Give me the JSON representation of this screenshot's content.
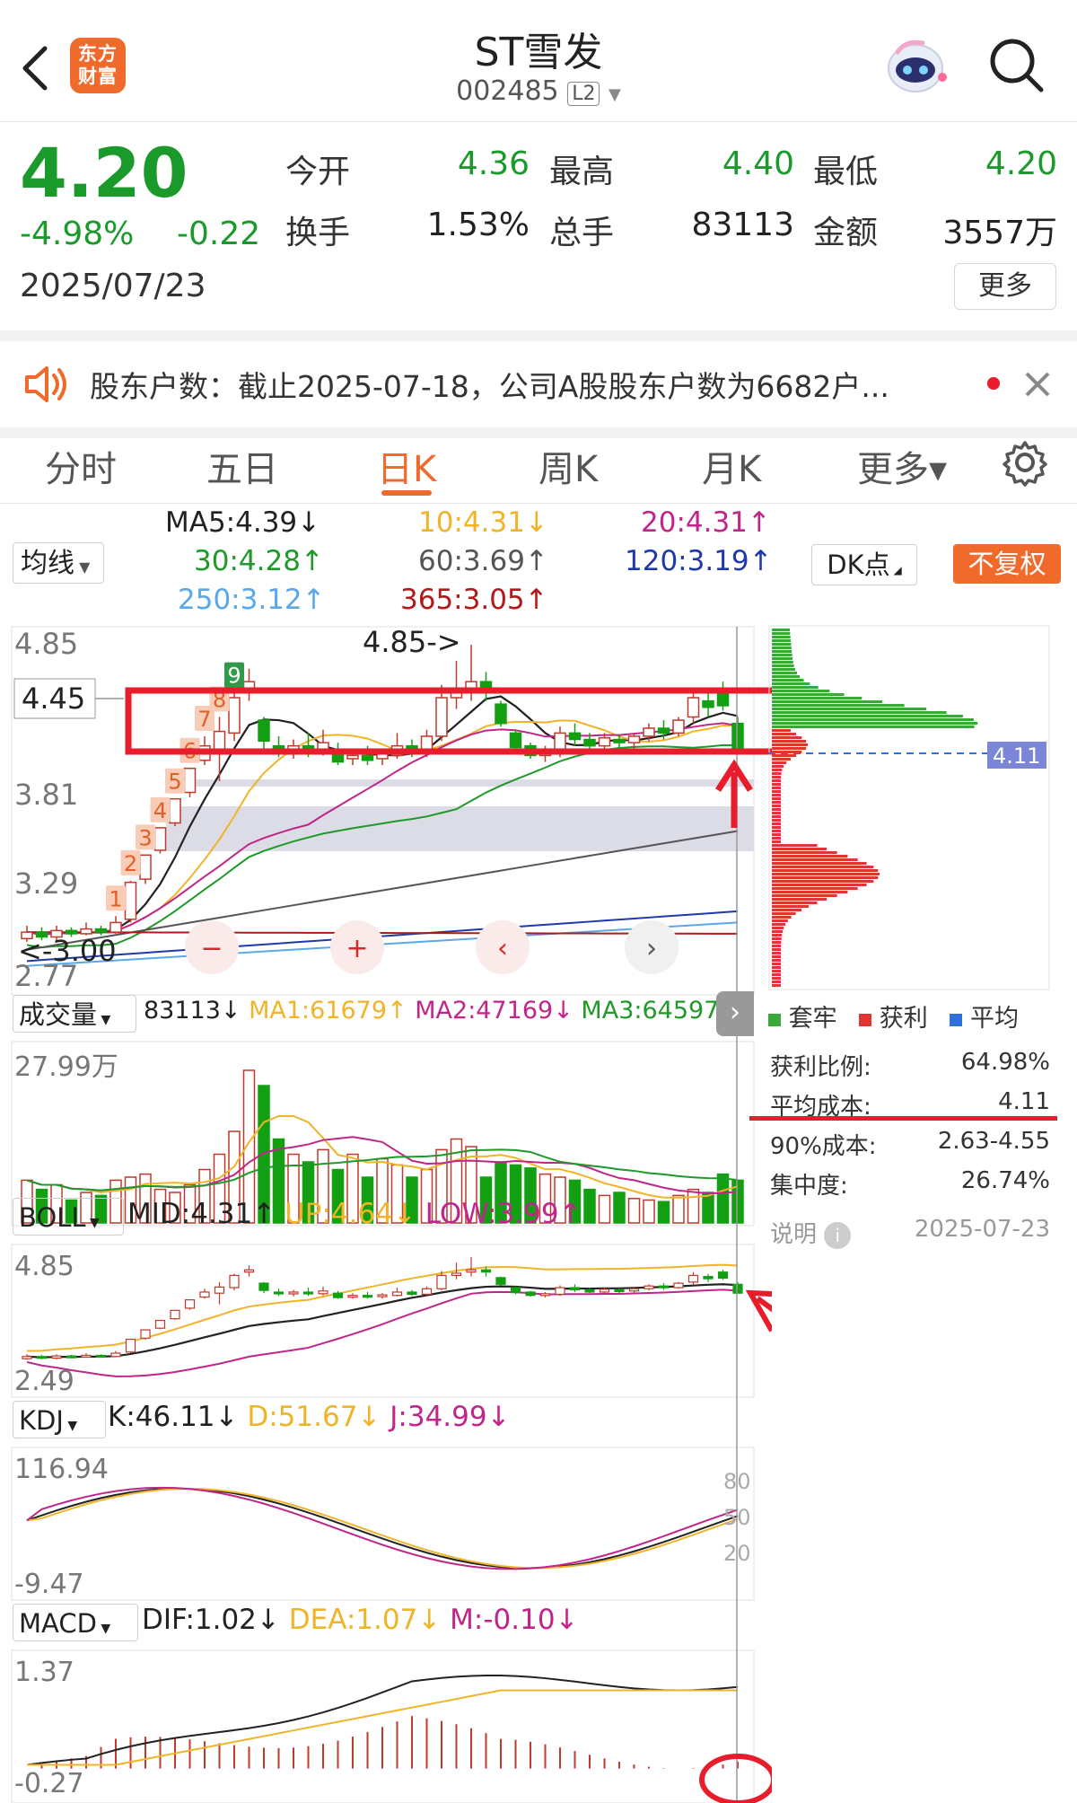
{
  "header": {
    "title": "ST雪发",
    "code": "002485",
    "level_badge": "L2",
    "app_logo_text": "东方财富",
    "icons": [
      "back-arrow-icon",
      "app-logo-icon",
      "robot-assistant-icon",
      "search-icon"
    ]
  },
  "quote": {
    "price": "4.20",
    "change_pct": "-4.98%",
    "change_amt": "-0.22",
    "date": "2025/07/23",
    "fields": [
      {
        "label": "今开",
        "value": "4.36",
        "color": "#1a9a2a"
      },
      {
        "label": "最高",
        "value": "4.40",
        "color": "#1a9a2a"
      },
      {
        "label": "最低",
        "value": "4.20",
        "color": "#1a9a2a"
      },
      {
        "label": "换手",
        "value": "1.53%",
        "color": "#222222"
      },
      {
        "label": "总手",
        "value": "83113",
        "color": "#222222"
      },
      {
        "label": "金额",
        "value": "3557万",
        "color": "#222222"
      }
    ],
    "more_button": "更多"
  },
  "notice": {
    "text": "股东户数：截止2025-07-18，公司A股股东户数为6682户...",
    "icons": [
      "speaker-icon",
      "red-dot-icon",
      "close-icon"
    ]
  },
  "tabs": {
    "items": [
      "分时",
      "五日",
      "日K",
      "周K",
      "月K",
      "更多▾"
    ],
    "active_index": 2,
    "settings_icon": "gear-icon"
  },
  "ma_panel": {
    "selector": "均线",
    "ma5": "MA5:4.39↓",
    "ma10": "10:4.31↓",
    "ma20": "20:4.31↑",
    "ma30": "30:4.28↑",
    "ma60": "60:3.69↑",
    "ma120": "120:3.19↑",
    "ma250": "250:3.12↑",
    "ma365": "365:3.05↑",
    "dk_button": "DK点",
    "adjust_button": "不复权",
    "colors": {
      "ma5": "#222222",
      "ma10": "#f0b429",
      "ma20": "#c0268a",
      "ma30": "#1f9a2a",
      "ma60": "#555555",
      "ma120": "#1f3aa8",
      "ma250": "#5aa8e8",
      "ma365": "#b01a1a"
    }
  },
  "main_chart": {
    "y_ticks": [
      "4.85",
      "4.45",
      "3.81",
      "3.29",
      "2.77"
    ],
    "high_annotation": "4.85->",
    "low_annotation": "<-3.00",
    "nine_turn_labels": [
      "1",
      "2",
      "3",
      "4",
      "5",
      "6",
      "7",
      "8",
      "9"
    ],
    "cost_label": "4.11"
  },
  "chip_legend": {
    "items": [
      {
        "label": "套牢",
        "color": "#3aa83a"
      },
      {
        "label": "获利",
        "color": "#e03535"
      },
      {
        "label": "平均",
        "color": "#2f6fd8"
      }
    ]
  },
  "chip_stats": {
    "rows": [
      {
        "label": "获利比例:",
        "value": "64.98%"
      },
      {
        "label": "平均成本:",
        "value": "4.11"
      },
      {
        "label": "90%成本:",
        "value": "2.63-4.55"
      },
      {
        "label": "集中度:",
        "value": "26.74%"
      }
    ],
    "explain": "说明",
    "date": "2025-07-23"
  },
  "volume_panel": {
    "selector": "成交量",
    "vol": "83113↓",
    "ma1": "MA1:61679↑",
    "ma2": "MA2:47169↓",
    "ma3": "MA3:64597↑",
    "y_top": "27.99万"
  },
  "boll_panel": {
    "selector": "BOLL",
    "mid": "MID:4.31↑",
    "up": "UP:4.64↓",
    "low": "LOW:3.99↑",
    "y_top": "4.85",
    "y_bottom": "2.49"
  },
  "kdj_panel": {
    "selector": "KDJ",
    "k": "K:46.11↓",
    "d": "D:51.67↓",
    "j": "J:34.99↓",
    "y_top": "116.94",
    "y_bottom": "-9.47",
    "levels": [
      "80",
      "50",
      "20"
    ]
  },
  "macd_panel": {
    "selector": "MACD",
    "dif": "DIF:1.02↓",
    "dea": "DEA:1.07↓",
    "m": "M:-0.10↓",
    "y_top": "1.37",
    "y_bottom": "-0.27"
  },
  "candles": [
    {
      "o": 3.02,
      "c": 3.06,
      "h": 3.1,
      "l": 3.0
    },
    {
      "o": 3.06,
      "c": 3.03,
      "h": 3.09,
      "l": 3.01
    },
    {
      "o": 3.03,
      "c": 3.07,
      "h": 3.1,
      "l": 3.01
    },
    {
      "o": 3.07,
      "c": 3.05,
      "h": 3.09,
      "l": 3.03
    },
    {
      "o": 3.05,
      "c": 3.08,
      "h": 3.12,
      "l": 3.04
    },
    {
      "o": 3.08,
      "c": 3.06,
      "h": 3.1,
      "l": 3.04
    },
    {
      "o": 3.06,
      "c": 3.12,
      "h": 3.16,
      "l": 3.05
    },
    {
      "o": 3.14,
      "c": 3.37,
      "h": 3.38,
      "l": 3.12
    },
    {
      "o": 3.39,
      "c": 3.54,
      "h": 3.54,
      "l": 3.36
    },
    {
      "o": 3.57,
      "c": 3.71,
      "h": 3.71,
      "l": 3.55
    },
    {
      "o": 3.74,
      "c": 3.89,
      "h": 3.89,
      "l": 3.72
    },
    {
      "o": 3.93,
      "c": 4.08,
      "h": 4.08,
      "l": 3.9
    },
    {
      "o": 4.13,
      "c": 4.22,
      "h": 4.28,
      "l": 4.1
    },
    {
      "o": 4.2,
      "c": 4.31,
      "h": 4.4,
      "l": 4.0
    },
    {
      "o": 4.3,
      "c": 4.52,
      "h": 4.55,
      "l": 4.25
    },
    {
      "o": 4.58,
      "c": 4.62,
      "h": 4.7,
      "l": 4.5
    },
    {
      "o": 4.38,
      "c": 4.25,
      "h": 4.4,
      "l": 4.2
    },
    {
      "o": 4.22,
      "c": 4.2,
      "h": 4.28,
      "l": 4.15
    },
    {
      "o": 4.2,
      "c": 4.22,
      "h": 4.26,
      "l": 4.14
    },
    {
      "o": 4.22,
      "c": 4.19,
      "h": 4.3,
      "l": 4.15
    },
    {
      "o": 4.19,
      "c": 4.24,
      "h": 4.32,
      "l": 4.16
    },
    {
      "o": 4.2,
      "c": 4.12,
      "h": 4.24,
      "l": 4.1
    },
    {
      "o": 4.14,
      "c": 4.16,
      "h": 4.2,
      "l": 4.1
    },
    {
      "o": 4.16,
      "c": 4.13,
      "h": 4.22,
      "l": 4.1
    },
    {
      "o": 4.14,
      "c": 4.17,
      "h": 4.2,
      "l": 4.1
    },
    {
      "o": 4.16,
      "c": 4.22,
      "h": 4.3,
      "l": 4.14
    },
    {
      "o": 4.22,
      "c": 4.18,
      "h": 4.26,
      "l": 4.15
    },
    {
      "o": 4.18,
      "c": 4.28,
      "h": 4.32,
      "l": 4.15
    },
    {
      "o": 4.28,
      "c": 4.52,
      "h": 4.6,
      "l": 4.25
    },
    {
      "o": 4.52,
      "c": 4.56,
      "h": 4.75,
      "l": 4.45
    },
    {
      "o": 4.58,
      "c": 4.62,
      "h": 4.85,
      "l": 4.5
    },
    {
      "o": 4.62,
      "c": 4.58,
      "h": 4.68,
      "l": 4.5
    },
    {
      "o": 4.48,
      "c": 4.36,
      "h": 4.5,
      "l": 4.34
    },
    {
      "o": 4.3,
      "c": 4.21,
      "h": 4.32,
      "l": 4.18
    },
    {
      "o": 4.22,
      "c": 4.16,
      "h": 4.24,
      "l": 4.14
    },
    {
      "o": 4.16,
      "c": 4.19,
      "h": 4.22,
      "l": 4.12
    },
    {
      "o": 4.18,
      "c": 4.3,
      "h": 4.34,
      "l": 4.15
    },
    {
      "o": 4.3,
      "c": 4.26,
      "h": 4.36,
      "l": 4.22
    },
    {
      "o": 4.26,
      "c": 4.22,
      "h": 4.3,
      "l": 4.2
    },
    {
      "o": 4.22,
      "c": 4.27,
      "h": 4.3,
      "l": 4.18
    },
    {
      "o": 4.26,
      "c": 4.24,
      "h": 4.29,
      "l": 4.2
    },
    {
      "o": 4.24,
      "c": 4.28,
      "h": 4.3,
      "l": 4.2
    },
    {
      "o": 4.28,
      "c": 4.33,
      "h": 4.36,
      "l": 4.25
    },
    {
      "o": 4.33,
      "c": 4.3,
      "h": 4.38,
      "l": 4.26
    },
    {
      "o": 4.3,
      "c": 4.38,
      "h": 4.4,
      "l": 4.28
    },
    {
      "o": 4.4,
      "c": 4.52,
      "h": 4.58,
      "l": 4.36
    },
    {
      "o": 4.5,
      "c": 4.46,
      "h": 4.55,
      "l": 4.4
    },
    {
      "o": 4.58,
      "c": 4.47,
      "h": 4.62,
      "l": 4.44
    },
    {
      "o": 4.36,
      "c": 4.2,
      "h": 4.4,
      "l": 4.2
    }
  ],
  "volumes": [
    0.28,
    0.22,
    0.25,
    0.15,
    0.2,
    0.18,
    0.28,
    0.3,
    0.32,
    0.22,
    0.2,
    0.25,
    0.35,
    0.45,
    0.6,
    1.0,
    0.9,
    0.55,
    0.45,
    0.4,
    0.48,
    0.35,
    0.45,
    0.3,
    0.42,
    0.38,
    0.3,
    0.35,
    0.48,
    0.55,
    0.5,
    0.3,
    0.4,
    0.38,
    0.36,
    0.32,
    0.3,
    0.28,
    0.22,
    0.18,
    0.2,
    0.16,
    0.15,
    0.14,
    0.18,
    0.22,
    0.2,
    0.32,
    0.28
  ]
}
